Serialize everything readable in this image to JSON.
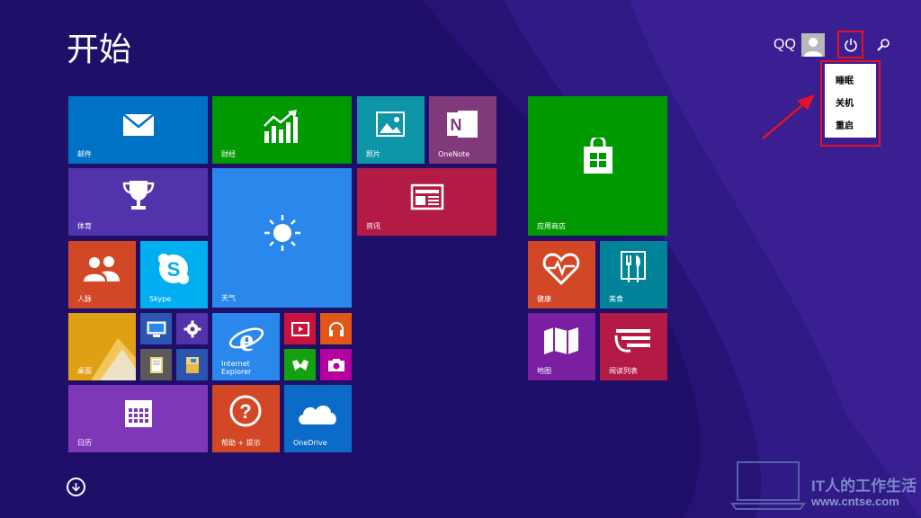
{
  "start_title": "开始",
  "user": {
    "name": "QQ"
  },
  "power_menu": {
    "items": [
      "睡眠",
      "关机",
      "重启"
    ]
  },
  "tiles": {
    "mail": "邮件",
    "finance": "财经",
    "photos": "照片",
    "onenote": "OneNote",
    "sports": "体育",
    "weather": "天气",
    "news": "资讯",
    "people": "人脉",
    "skype": "Skype",
    "desktop": "桌面",
    "ie": "Internet Explorer",
    "calendar": "日历",
    "help": "帮助 + 提示",
    "onedrive": "OneDrive",
    "store": "应用商店",
    "health": "健康",
    "food": "美食",
    "maps": "地图",
    "reading": "阅读列表"
  },
  "ie_lines": [
    "Internet",
    "Explorer"
  ],
  "watermark": {
    "title": "IT人的工作生活",
    "url": "www.cntse.com"
  },
  "colors": {
    "background": "#1f0f68",
    "mail": "#0072c6",
    "finance": "#009a00",
    "photos": "#0e95a8",
    "onenote": "#80397b",
    "sports": "#5133ab",
    "weather": "#2a88ec",
    "news": "#b31b45",
    "people": "#d24726",
    "skype": "#00aff0",
    "store": "#009a00",
    "health": "#d24726",
    "food": "#008299",
    "maps": "#7b1fa2",
    "reading": "#b31b45",
    "highlight": "#e81123"
  }
}
